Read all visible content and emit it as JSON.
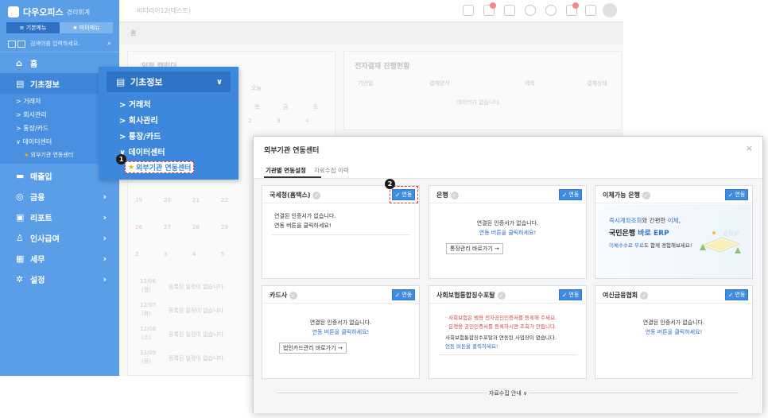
{
  "sidebar": {
    "brand": "다우오피스",
    "brand_sub": "경리회계",
    "tabs": [
      "기본메뉴",
      "마이메뉴"
    ],
    "search_placeholder": "검색어를 입력하세요.",
    "items": [
      {
        "label": "홈",
        "icon": "home-icon"
      },
      {
        "label": "기초정보",
        "icon": "list-icon"
      },
      {
        "label": "매출입",
        "icon": "card-icon"
      },
      {
        "label": "금융",
        "icon": "money-icon"
      },
      {
        "label": "리포트",
        "icon": "report-icon"
      },
      {
        "label": "인사급여",
        "icon": "people-icon"
      },
      {
        "label": "세무",
        "icon": "tax-icon"
      },
      {
        "label": "설정",
        "icon": "gear-icon"
      }
    ],
    "subitems": [
      "거래처",
      "회사관리",
      "통장/카드",
      "데이터센터",
      "외부기관 연동센터"
    ]
  },
  "flyout": {
    "title": "기초정보",
    "items": [
      "거래처",
      "회사관리",
      "통장/카드",
      "데이터센터"
    ],
    "favorite": "외부기관 연동센터",
    "callout": "1"
  },
  "topbar": {
    "company": "비티라이12(테스트)",
    "tab": "홈",
    "badge1": "8",
    "badge2": "9"
  },
  "background": {
    "schedule_title": "일정 캘린더",
    "approval_title": "전자결재 진행현황",
    "today": "오늘",
    "weekdays": [
      "목",
      "금",
      "토"
    ],
    "approval_cols": [
      "기안일",
      "결재양식",
      "제목",
      "결재상태"
    ],
    "empty_approval": "데이터가 없습니다.",
    "cal_days": [
      "2",
      "3",
      "4",
      "19",
      "20",
      "21",
      "22",
      "26",
      "27",
      "28",
      "29",
      "2",
      "3",
      "4",
      "5"
    ],
    "date_rows": [
      {
        "date": "12/06",
        "day": "(월)",
        "text": "등록된 일정이 없습니다."
      },
      {
        "date": "12/07",
        "day": "(화)",
        "text": "등록된 일정이 없습니다."
      },
      {
        "date": "12/08",
        "day": "(수)",
        "text": "등록된 일정이 없습니다."
      },
      {
        "date": "12/09",
        "day": "(목)",
        "text": "등록된 일정이 없습니다."
      }
    ]
  },
  "modal": {
    "title": "외부기관 연동센터",
    "tabs": [
      "기관별 연동설정",
      "자료수집 이력"
    ],
    "link_label": "연동",
    "callout": "2",
    "footer": "자료수집 안내 ∨",
    "cards": [
      {
        "title": "국세청(홈택스)",
        "lines": [
          "연결된 인증서가 없습니다.",
          "연동 버튼을 클릭하세요!"
        ]
      },
      {
        "title": "은행",
        "lines": [
          "연결된 인증서가 없습니다.",
          "연동 버튼을 클릭하세요!"
        ],
        "button": "통장관리 바로가기 →"
      },
      {
        "title": "이체가능 은행",
        "ad": {
          "line1_a": "즉시계좌조회",
          "line1_b": "와 간편한 ",
          "line1_c": "이체",
          "line1_d": ",",
          "line2_a": "국민은행 ",
          "line2_b": "바로 ERP",
          "line3_a": "이체수수료 무료",
          "line3_b": "도 함께 경험해보세요!"
        }
      },
      {
        "title": "카드사",
        "lines": [
          "연결된 인증서가 없습니다.",
          "연동 버튼을 클릭하세요!"
        ],
        "button": "법인카드관리 바로가기 →"
      },
      {
        "title": "사회보험통합징수포탈",
        "bullets": [
          "· 사회보험은 범용 전자공인인증서를 등록해 주세요.",
          "· 은행용 공인인증서를 등록하시면 조회가 안됩니다."
        ],
        "lines": [
          "사회보험통합징수포탈과 연동된 사업장이 없습니다.",
          "연동 버튼을 클릭하세요!"
        ]
      },
      {
        "title": "여신금융협회",
        "lines": [
          "연결된 인증서가 없습니다.",
          "연동 버튼을 클릭하세요!"
        ]
      }
    ]
  },
  "colors": {
    "sidebar": "#5b9ee8",
    "sidebar_active": "#3f86d8",
    "flyout": "#3d88dd",
    "accent": "#3f8de0",
    "callout_border": "#e53b3b"
  }
}
